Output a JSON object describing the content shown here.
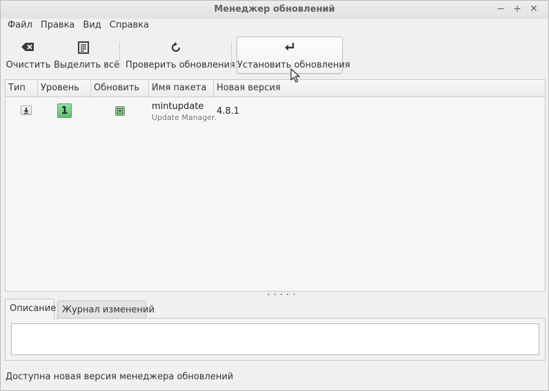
{
  "window": {
    "title": "Менеджер обновлений",
    "controls": {
      "minimize": "−",
      "maximize": "+",
      "close": "✕"
    }
  },
  "menu": {
    "items": [
      "Файл",
      "Правка",
      "Вид",
      "Справка"
    ]
  },
  "toolbar": {
    "clear_label": "Очистить",
    "select_all_label": "Выделить всё",
    "refresh_label": "Проверить обновления",
    "install_label": "Установить обновления"
  },
  "updates_table": {
    "columns": [
      "Тип",
      "Уровень",
      "Обновить",
      "Имя пакета",
      "Новая версия"
    ],
    "rows": [
      {
        "type_icon": "package-download-icon",
        "level": "1",
        "update_checked": true,
        "package_name": "mintupdate",
        "description": "Update Manager.",
        "new_version": "4.8.1"
      }
    ]
  },
  "tabs": {
    "description": "Описание",
    "changelog": "Журнал изменений"
  },
  "status": {
    "text": "Доступна новая версия менеджера обновлений"
  },
  "colors": {
    "level_badge": "#5fbf6b",
    "checkbox": "#b8dfb6"
  }
}
